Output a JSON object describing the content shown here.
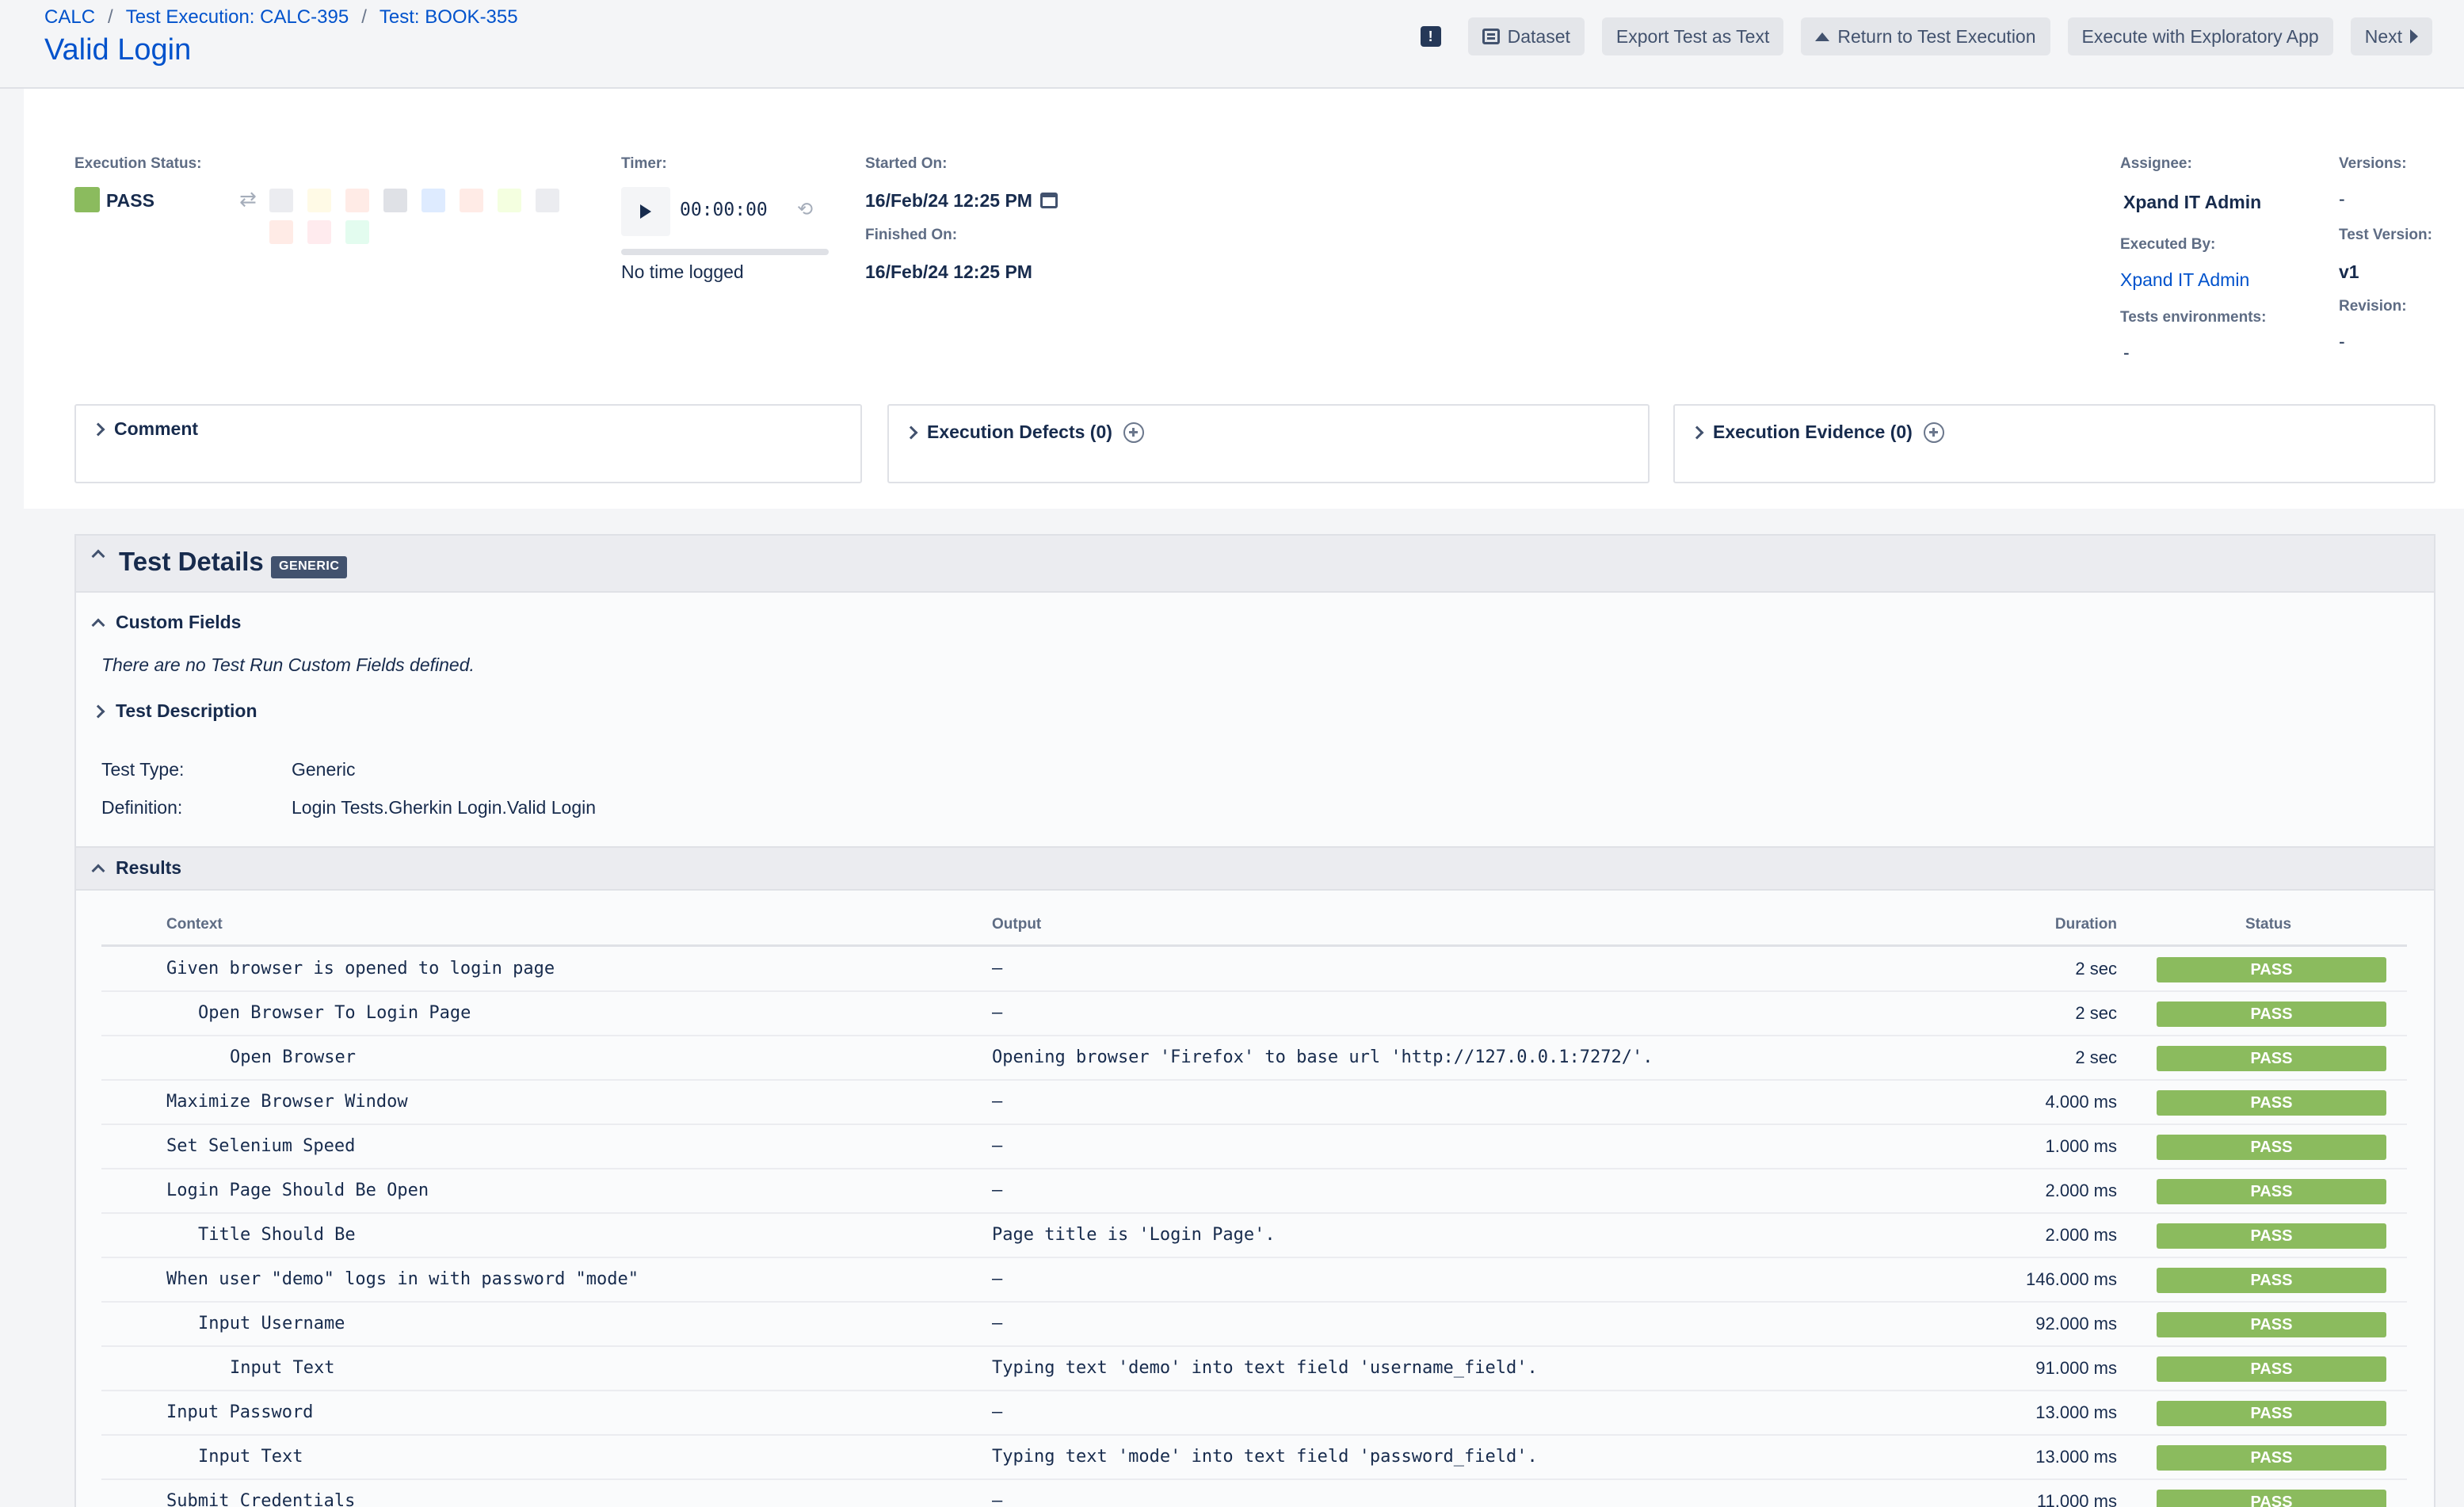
{
  "breadcrumb": {
    "project": "CALC",
    "execution": "Test Execution: CALC-395",
    "test": "Test: BOOK-355",
    "separator": "/"
  },
  "page_title": "Valid Login",
  "toolbar": {
    "feedback_icon": "feedback-icon",
    "dataset": "Dataset",
    "export": "Export Test as Text",
    "return": "Return to Test Execution",
    "exploratory": "Execute with Exploratory App",
    "next": "Next"
  },
  "execution": {
    "status_label": "Execution Status:",
    "status": "PASS",
    "status_color": "#8bbb5e",
    "status_chips": [
      "#ebecf0",
      "#fffae6",
      "#ffebe6",
      "#dfe1e6",
      "#deebff",
      "#ffebe6",
      "#f4ffe0",
      "#ebecf0",
      "#ffebe6",
      "#ffebee",
      "#e3fcef"
    ],
    "timer_label": "Timer:",
    "timer_value": "00:00:00",
    "no_time": "No time logged",
    "started_label": "Started On:",
    "started_value": "16/Feb/24 12:25 PM",
    "finished_label": "Finished On:",
    "finished_value": "16/Feb/24 12:25 PM",
    "assignee_label": "Assignee:",
    "assignee_value": "Xpand IT Admin",
    "executed_by_label": "Executed By:",
    "executed_by_value": "Xpand IT Admin",
    "envs_label": "Tests environments:",
    "envs_value": "-",
    "versions_label": "Versions:",
    "versions_value": "-",
    "test_version_label": "Test Version:",
    "test_version_value": "v1",
    "revision_label": "Revision:",
    "revision_value": "-"
  },
  "boxes": {
    "comment": "Comment",
    "defects": "Execution Defects (0)",
    "evidence": "Execution Evidence (0)"
  },
  "details": {
    "title": "Test Details",
    "badge": "GENERIC",
    "custom_fields": "Custom Fields",
    "no_custom": "There are no Test Run Custom Fields defined.",
    "test_description": "Test Description",
    "test_type_key": "Test Type:",
    "test_type_val": "Generic",
    "definition_key": "Definition:",
    "definition_val": "Login Tests.Gherkin Login.Valid Login",
    "results": "Results"
  },
  "results": {
    "columns": [
      "Context",
      "Output",
      "Duration",
      "Status"
    ],
    "rows": [
      {
        "context": "Given browser is opened to login page",
        "indent": 0,
        "output": "–",
        "duration": "2 sec",
        "status": "PASS"
      },
      {
        "context": "Open Browser To Login Page",
        "indent": 1,
        "output": "–",
        "duration": "2 sec",
        "status": "PASS"
      },
      {
        "context": "Open Browser",
        "indent": 2,
        "output": "Opening browser 'Firefox' to base url 'http://127.0.0.1:7272/'.",
        "duration": "2 sec",
        "status": "PASS"
      },
      {
        "context": "Maximize Browser Window",
        "indent": 0,
        "output": "–",
        "duration": "4.000 ms",
        "status": "PASS"
      },
      {
        "context": "Set Selenium Speed",
        "indent": 0,
        "output": "–",
        "duration": "1.000 ms",
        "status": "PASS"
      },
      {
        "context": "Login Page Should Be Open",
        "indent": 0,
        "output": "–",
        "duration": "2.000 ms",
        "status": "PASS"
      },
      {
        "context": "Title Should Be",
        "indent": 1,
        "output": "Page title is 'Login Page'.",
        "duration": "2.000 ms",
        "status": "PASS"
      },
      {
        "context": "When user \"demo\" logs in with password \"mode\"",
        "indent": 0,
        "output": "–",
        "duration": "146.000 ms",
        "status": "PASS"
      },
      {
        "context": "Input Username",
        "indent": 1,
        "output": "–",
        "duration": "92.000 ms",
        "status": "PASS"
      },
      {
        "context": "Input Text",
        "indent": 2,
        "output": "Typing text 'demo' into text field 'username_field'.",
        "duration": "91.000 ms",
        "status": "PASS"
      },
      {
        "context": "Input Password",
        "indent": 0,
        "output": "–",
        "duration": "13.000 ms",
        "status": "PASS"
      },
      {
        "context": "Input Text",
        "indent": 1,
        "output": "Typing text 'mode' into text field 'password_field'.",
        "duration": "13.000 ms",
        "status": "PASS"
      },
      {
        "context": "Submit Credentials",
        "indent": 0,
        "output": "–",
        "duration": "11.000 ms",
        "status": "PASS"
      }
    ]
  }
}
